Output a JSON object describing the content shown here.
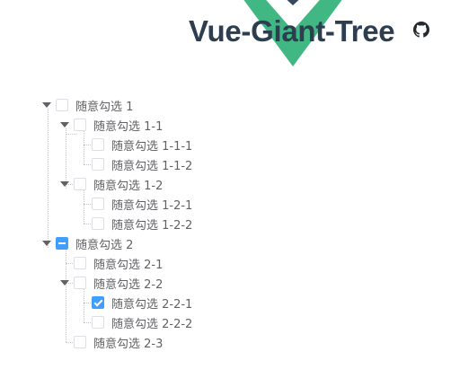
{
  "header": {
    "title": "Vue-Giant-Tree",
    "logo_colors": {
      "outer": "#41b883",
      "inner": "#35495e"
    },
    "github_icon": "github-icon"
  },
  "tree": {
    "accent_color": "#409eff",
    "nodes": [
      {
        "label": "随意勾选 1",
        "state": "unchecked",
        "expanded": true,
        "leaf": false
      },
      {
        "label": "随意勾选 1-1",
        "state": "unchecked",
        "expanded": true,
        "leaf": false
      },
      {
        "label": "随意勾选 1-1-1",
        "state": "unchecked",
        "leaf": true
      },
      {
        "label": "随意勾选 1-1-2",
        "state": "unchecked",
        "leaf": true
      },
      {
        "label": "随意勾选 1-2",
        "state": "unchecked",
        "expanded": true,
        "leaf": false
      },
      {
        "label": "随意勾选 1-2-1",
        "state": "unchecked",
        "leaf": true
      },
      {
        "label": "随意勾选 1-2-2",
        "state": "unchecked",
        "leaf": true
      },
      {
        "label": "随意勾选 2",
        "state": "indeterminate",
        "expanded": true,
        "leaf": false
      },
      {
        "label": "随意勾选 2-1",
        "state": "unchecked",
        "leaf": true
      },
      {
        "label": "随意勾选 2-2",
        "state": "indeterminate",
        "expanded": true,
        "leaf": false
      },
      {
        "label": "随意勾选 2-2-1",
        "state": "checked",
        "leaf": true
      },
      {
        "label": "随意勾选 2-2-2",
        "state": "unchecked",
        "leaf": true
      },
      {
        "label": "随意勾选 2-3",
        "state": "unchecked",
        "leaf": true
      }
    ]
  }
}
